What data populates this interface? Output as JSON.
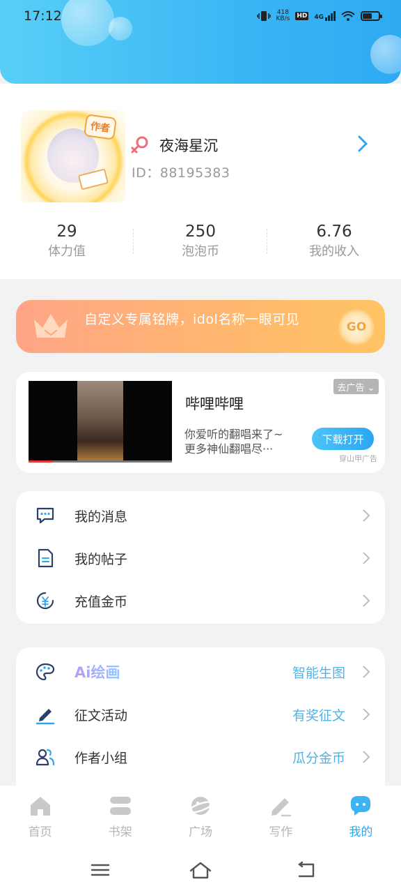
{
  "status_bar": {
    "time": "17:12",
    "net_speed_top": "418",
    "net_speed_bottom": "KB/s",
    "hd": "HD",
    "signal": "4G"
  },
  "profile": {
    "avatar_badge": "作者",
    "nickname": "夜海星沉",
    "user_id": "ID：88195383",
    "stats": [
      {
        "value": "29",
        "label": "体力值"
      },
      {
        "value": "250",
        "label": "泡泡币"
      },
      {
        "value": "6.76",
        "label": "我的收入"
      }
    ]
  },
  "banner": {
    "text": "自定义专属铭牌，idol名称一眼可见",
    "go": "GO"
  },
  "ad": {
    "title": "哔哩哔哩",
    "desc_line1": "你爱听的翻唱来了~",
    "desc_line2": "更多神仙翻唱尽···",
    "remove": "去广告 ⌄",
    "download": "下载打开",
    "source": "穿山甲广告"
  },
  "menu1": [
    {
      "label": "我的消息",
      "icon": "message-icon"
    },
    {
      "label": "我的帖子",
      "icon": "post-icon"
    },
    {
      "label": "充值金币",
      "icon": "coin-icon"
    }
  ],
  "menu2": [
    {
      "label": "Ai绘画",
      "right": "智能生图",
      "icon": "palette-icon"
    },
    {
      "label": "征文活动",
      "right": "有奖征文",
      "icon": "pen-icon"
    },
    {
      "label": "作者小组",
      "right": "瓜分金币",
      "icon": "group-icon"
    }
  ],
  "tabs": [
    {
      "label": "首页",
      "icon": "home-icon"
    },
    {
      "label": "书架",
      "icon": "bookshelf-icon"
    },
    {
      "label": "广场",
      "icon": "planet-icon"
    },
    {
      "label": "写作",
      "icon": "write-icon"
    },
    {
      "label": "我的",
      "icon": "mine-icon",
      "active": true
    }
  ],
  "colors": {
    "accent": "#28a9ef",
    "banner_start": "#ffa487",
    "banner_end": "#ffc464",
    "header": "#3ab6f4"
  }
}
